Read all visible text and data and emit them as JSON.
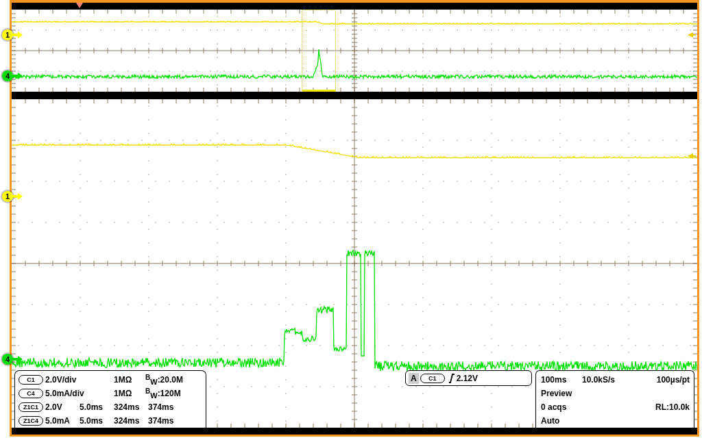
{
  "overview": {
    "channel_markers": [
      {
        "label": "1",
        "color": "#ffff00"
      },
      {
        "label": "4",
        "color": "#00dd00"
      }
    ]
  },
  "main": {
    "channel_markers": [
      {
        "label": "1",
        "color": "#ffff00"
      },
      {
        "label": "4",
        "color": "#00dd00"
      }
    ]
  },
  "channel_readouts": [
    {
      "channel": "C1",
      "scale": "2.0V/div",
      "impedance": "1MΩ",
      "bandwidth": "$^{B}$$_{W}$:20.0M"
    },
    {
      "channel": "C4",
      "scale": "5.0mA/div",
      "impedance": "1MΩ",
      "bandwidth": "$^{B}$$_{W}$:120M"
    }
  ],
  "zoom_readouts": [
    {
      "channel": "Z1C1",
      "scale": "2.0V",
      "time_scale": "5.0ms",
      "start": "324ms",
      "end": "374ms"
    },
    {
      "channel": "Z1C4",
      "scale": "5.0mA",
      "time_scale": "5.0ms",
      "start": "324ms",
      "end": "374ms"
    }
  ],
  "trigger": {
    "mode": "A",
    "source": "C1",
    "level": "2.12V"
  },
  "acquisition": {
    "horizontal_scale": "100ms",
    "sample_rate": "10.0kS/s",
    "resolution": "100µs/pt",
    "state": "Preview",
    "acquisitions": "0 acqs",
    "record_length": "RL:10.0k",
    "trigger_mode": "Auto"
  }
}
